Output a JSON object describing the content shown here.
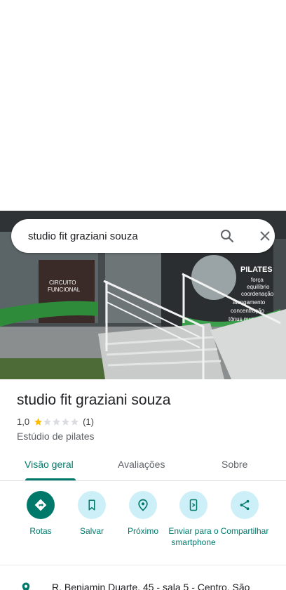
{
  "search": {
    "query": "studio fit graziani souza"
  },
  "photo": {
    "sign_left": "CIRCUITO\nFUNCIONAL",
    "sign_right_title": "PILATES",
    "sign_right_lines": [
      "força",
      "equilíbrio",
      "coordenação",
      "alongamento",
      "concentração",
      "tônus muscular"
    ]
  },
  "place": {
    "title": "studio fit graziani souza",
    "rating": "1,0",
    "stars_filled": 1,
    "stars_total": 5,
    "review_count": "(1)",
    "category": "Estúdio de pilates"
  },
  "tabs": [
    {
      "label": "Visão geral",
      "active": true
    },
    {
      "label": "Avaliações",
      "active": false
    },
    {
      "label": "Sobre",
      "active": false
    }
  ],
  "actions": [
    {
      "label": "Rotas",
      "icon": "directions-icon"
    },
    {
      "label": "Salvar",
      "icon": "bookmark-icon"
    },
    {
      "label": "Próximo",
      "icon": "nearby-icon"
    },
    {
      "label": "Enviar para o smartphone",
      "icon": "send-to-phone-icon"
    },
    {
      "label": "Compartilhar",
      "icon": "share-icon"
    }
  ],
  "address": {
    "text": "R. Benjamin Duarte, 45 - sala 5 - Centro, São"
  },
  "colors": {
    "accent": "#00796b",
    "action_bg": "#cdeff7",
    "star": "#fbbc04"
  }
}
